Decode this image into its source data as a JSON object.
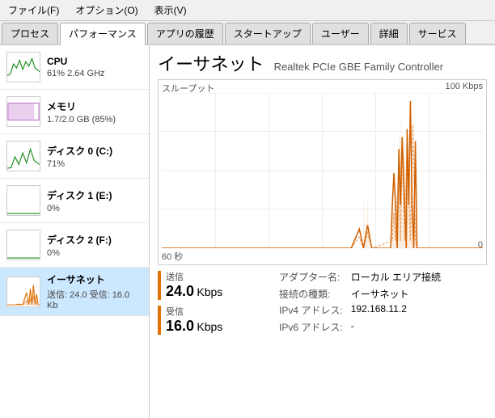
{
  "menuBar": {
    "items": [
      {
        "id": "file",
        "label": "ファイル(F)"
      },
      {
        "id": "options",
        "label": "オプション(O)"
      },
      {
        "id": "view",
        "label": "表示(V)"
      }
    ]
  },
  "tabs": [
    {
      "id": "process",
      "label": "プロセス",
      "active": false
    },
    {
      "id": "performance",
      "label": "パフォーマンス",
      "active": true
    },
    {
      "id": "appHistory",
      "label": "アプリの履歴",
      "active": false
    },
    {
      "id": "startup",
      "label": "スタートアップ",
      "active": false
    },
    {
      "id": "users",
      "label": "ユーザー",
      "active": false
    },
    {
      "id": "details",
      "label": "詳細",
      "active": false
    },
    {
      "id": "services",
      "label": "サービス",
      "active": false
    }
  ],
  "sidebar": {
    "items": [
      {
        "id": "cpu",
        "label": "CPU",
        "sublabel": "61%  2.64 GHz",
        "selected": false
      },
      {
        "id": "memory",
        "label": "メモリ",
        "sublabel": "1.7/2.0 GB (85%)",
        "selected": false
      },
      {
        "id": "disk0",
        "label": "ディスク 0 (C:)",
        "sublabel": "71%",
        "selected": false
      },
      {
        "id": "disk1",
        "label": "ディスク 1 (E:)",
        "sublabel": "0%",
        "selected": false
      },
      {
        "id": "disk2",
        "label": "ディスク 2 (F:)",
        "sublabel": "0%",
        "selected": false
      },
      {
        "id": "ethernet",
        "label": "イーサネット",
        "sublabel": "送信: 24.0 受信: 16.0 Kb",
        "selected": true
      }
    ]
  },
  "main": {
    "title": "イーサネット",
    "subtitle": "Realtek PCIe GBE Family Controller",
    "chartLabels": {
      "throughput": "スループット",
      "maxKbps": "100 Kbps",
      "minVal": "0",
      "timeLabel": "60 秒"
    },
    "stats": {
      "send": {
        "label": "送信",
        "value": "24.0",
        "unit": "Kbps"
      },
      "receive": {
        "label": "受信",
        "value": "16.0",
        "unit": "Kbps"
      }
    },
    "info": {
      "adapterLabel": "アダプター名:",
      "adapterValue": "ローカル エリア接続",
      "connectionTypeLabel": "接続の種類:",
      "connectionTypeValue": "イーサネット",
      "ipv4Label": "IPv4 アドレス:",
      "ipv4Value": "192.168.11.2",
      "ipv6Label": "IPv6 アドレス:",
      "ipv6Value": "-"
    }
  }
}
